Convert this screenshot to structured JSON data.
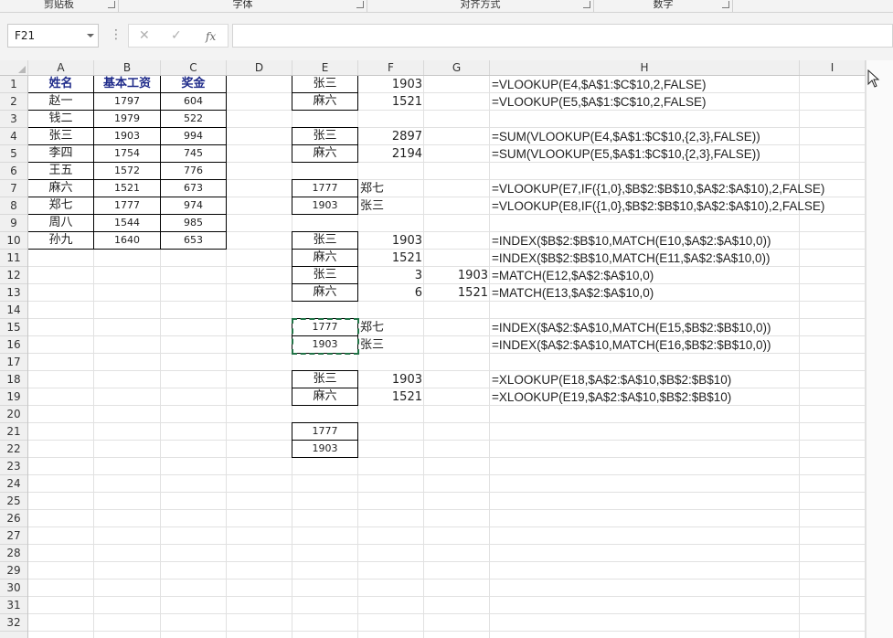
{
  "ribbon": {
    "groups": [
      {
        "label": "剪贴板"
      },
      {
        "label": "字体"
      },
      {
        "label": "对齐方式"
      },
      {
        "label": "数字"
      }
    ]
  },
  "formula_bar": {
    "name_box": "F21",
    "cancel_glyph": "✕",
    "enter_glyph": "✓",
    "fx_glyph": "fx",
    "content": ""
  },
  "columns": [
    "A",
    "B",
    "C",
    "D",
    "E",
    "F",
    "G",
    "H",
    "I"
  ],
  "rows": [
    "1",
    "2",
    "3",
    "4",
    "5",
    "6",
    "7",
    "8",
    "9",
    "10",
    "11",
    "12",
    "13",
    "14",
    "15",
    "16",
    "17",
    "18",
    "19",
    "20",
    "21",
    "22",
    "23",
    "24",
    "25",
    "26",
    "27",
    "28",
    "29",
    "30",
    "31",
    "32"
  ],
  "table": {
    "headers": [
      "姓名",
      "基本工资",
      "奖金"
    ],
    "rows": [
      [
        "赵一",
        "1797",
        "604"
      ],
      [
        "钱二",
        "1979",
        "522"
      ],
      [
        "张三",
        "1903",
        "994"
      ],
      [
        "李四",
        "1754",
        "745"
      ],
      [
        "王五",
        "1572",
        "776"
      ],
      [
        "麻六",
        "1521",
        "673"
      ],
      [
        "郑七",
        "1777",
        "974"
      ],
      [
        "周八",
        "1544",
        "985"
      ],
      [
        "孙九",
        "1640",
        "653"
      ]
    ]
  },
  "cells": {
    "E1": "张三",
    "F1": "1903",
    "H1": "=VLOOKUP(E4,$A$1:$C$10,2,FALSE)",
    "E2": "麻六",
    "F2": "1521",
    "H2": "=VLOOKUP(E5,$A$1:$C$10,2,FALSE)",
    "E4": "张三",
    "F4": "2897",
    "H4": "=SUM(VLOOKUP(E4,$A$1:$C$10,{2,3},FALSE))",
    "E5": "麻六",
    "F5": "2194",
    "H5": "=SUM(VLOOKUP(E5,$A$1:$C$10,{2,3},FALSE))",
    "E7": "1777",
    "F7": "郑七",
    "H7": "=VLOOKUP(E7,IF({1,0},$B$2:$B$10,$A$2:$A$10),2,FALSE)",
    "E8": "1903",
    "F8": "张三",
    "H8": "=VLOOKUP(E8,IF({1,0},$B$2:$B$10,$A$2:$A$10),2,FALSE)",
    "E10": "张三",
    "F10": "1903",
    "H10": "=INDEX($B$2:$B$10,MATCH(E10,$A$2:$A$10,0))",
    "E11": "麻六",
    "F11": "1521",
    "H11": "=INDEX($B$2:$B$10,MATCH(E11,$A$2:$A$10,0))",
    "E12": "张三",
    "F12": "3",
    "G12": "1903",
    "H12": "=MATCH(E12,$A$2:$A$10,0)",
    "E13": "麻六",
    "F13": "6",
    "G13": "1521",
    "H13": "=MATCH(E13,$A$2:$A$10,0)",
    "E15": "1777",
    "F15": "郑七",
    "H15": "=INDEX($A$2:$A$10,MATCH(E15,$B$2:$B$10,0))",
    "E16": "1903",
    "F16": "张三",
    "H16": "=INDEX($A$2:$A$10,MATCH(E16,$B$2:$B$10,0))",
    "E18": "张三",
    "F18": "1903",
    "H18": "=XLOOKUP(E18,$A$2:$A$10,$B$2:$B$10)",
    "E19": "麻六",
    "F19": "1521",
    "H19": "=XLOOKUP(E19,$A$2:$A$10,$B$2:$B$10)",
    "E21": "1777",
    "E22": "1903"
  },
  "colors": {
    "header_text": "#1f2b8a",
    "copy_marquee": "#217346",
    "grid": "#e1e1e1"
  }
}
